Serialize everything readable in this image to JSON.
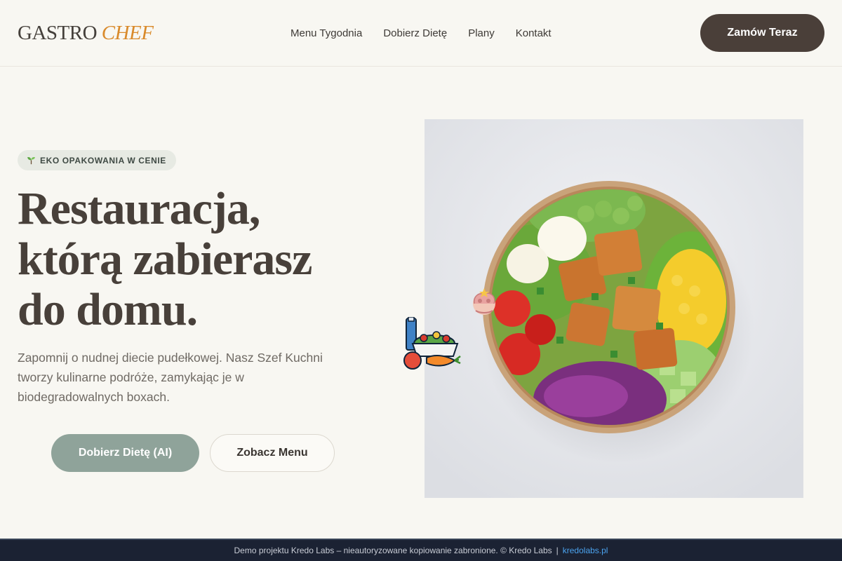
{
  "brand": {
    "name_part1": "GASTRO",
    "name_part2": "CHEF",
    "accent_color": "#d98a2b"
  },
  "nav": {
    "items": [
      "Menu Tygodnia",
      "Dobierz Dietę",
      "Plany",
      "Kontakt"
    ]
  },
  "header_cta": {
    "label": "Zamów Teraz"
  },
  "hero": {
    "badge": {
      "icon": "seedling-icon",
      "label": "EKO OPAKOWANIA W CENIE"
    },
    "title_lines": [
      "Restauracja,",
      "którą zabierasz",
      "do domu."
    ],
    "lead": "Zapomnij o nudnej diecie pudełkowej. Nasz Szef Kuchni tworzy kulinarne podróże, zamykając je w biodegradowalnych boxach.",
    "primary_button": "Dobierz Dietę (AI)",
    "secondary_button": "Zobacz Menu",
    "image": "salad-bowl-photo"
  },
  "stickers": [
    "brain-icon",
    "food-basket-icon"
  ],
  "footer": {
    "text": "Demo projektu Kredo Labs – nieautoryzowane kopiowanie zabronione. © Kredo Labs",
    "separator": "|",
    "link": "kredolabs.pl"
  },
  "colors": {
    "dark": "#4a3f39",
    "sage": "#8fa39a",
    "footer_bg": "#1b2233",
    "link": "#4ba3ef"
  }
}
